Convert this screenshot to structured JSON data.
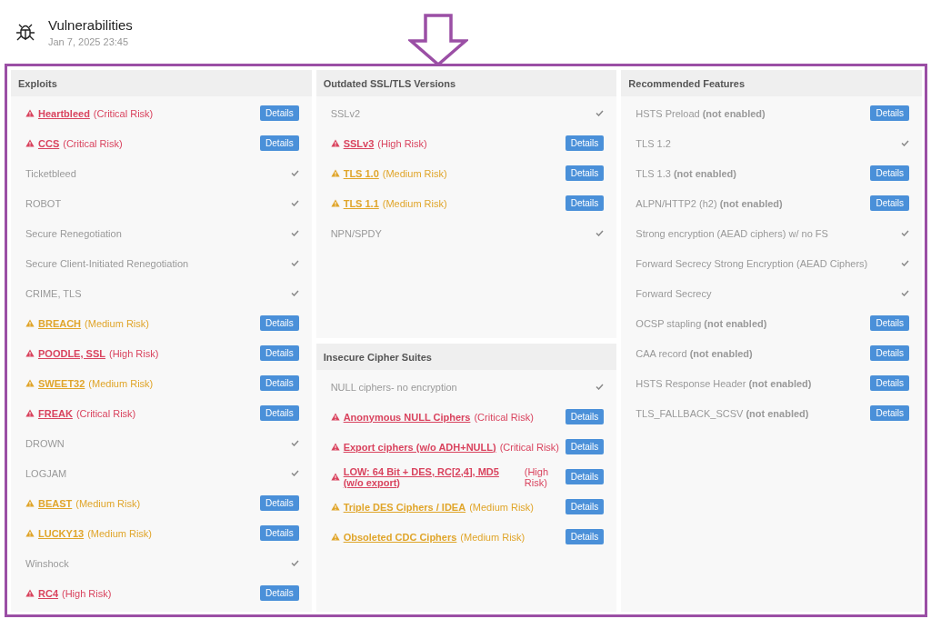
{
  "header": {
    "title": "Vulnerabilities",
    "date": "Jan 7, 2025 23:45"
  },
  "columns": [
    {
      "cards": [
        {
          "title": "Exploits",
          "items": [
            {
              "kind": "risk",
              "name": "Heartbleed",
              "risk": "(Critical Risk)",
              "color": "#d9435e",
              "button": "Details"
            },
            {
              "kind": "risk",
              "name": "CCS",
              "risk": "(Critical Risk)",
              "color": "#d9435e",
              "button": "Details"
            },
            {
              "kind": "ok",
              "name": "Ticketbleed"
            },
            {
              "kind": "ok",
              "name": "ROBOT"
            },
            {
              "kind": "ok",
              "name": "Secure Renegotiation"
            },
            {
              "kind": "ok",
              "name": "Secure Client-Initiated Renegotiation"
            },
            {
              "kind": "ok",
              "name": "CRIME, TLS"
            },
            {
              "kind": "risk",
              "name": "BREACH",
              "risk": "(Medium Risk)",
              "color": "#e0a52a",
              "button": "Details"
            },
            {
              "kind": "risk",
              "name": "POODLE, SSL",
              "risk": "(High Risk)",
              "color": "#d9435e",
              "button": "Details"
            },
            {
              "kind": "risk",
              "name": "SWEET32",
              "risk": "(Medium Risk)",
              "color": "#e0a52a",
              "button": "Details"
            },
            {
              "kind": "risk",
              "name": "FREAK",
              "risk": "(Critical Risk)",
              "color": "#d9435e",
              "button": "Details"
            },
            {
              "kind": "ok",
              "name": "DROWN"
            },
            {
              "kind": "ok",
              "name": "LOGJAM"
            },
            {
              "kind": "risk",
              "name": "BEAST",
              "risk": "(Medium Risk)",
              "color": "#e0a52a",
              "button": "Details"
            },
            {
              "kind": "risk",
              "name": "LUCKY13",
              "risk": "(Medium Risk)",
              "color": "#e0a52a",
              "button": "Details"
            },
            {
              "kind": "ok",
              "name": "Winshock"
            },
            {
              "kind": "risk",
              "name": "RC4",
              "risk": "(High Risk)",
              "color": "#d9435e",
              "button": "Details"
            }
          ]
        }
      ]
    },
    {
      "cards": [
        {
          "title": "Outdated SSL/TLS Versions",
          "items": [
            {
              "kind": "ok",
              "name": "SSLv2"
            },
            {
              "kind": "risk",
              "name": "SSLv3",
              "risk": "(High Risk)",
              "color": "#d9435e",
              "button": "Details"
            },
            {
              "kind": "risk",
              "name": "TLS 1.0",
              "risk": "(Medium Risk)",
              "color": "#e0a52a",
              "button": "Details"
            },
            {
              "kind": "risk",
              "name": "TLS 1.1",
              "risk": "(Medium Risk)",
              "color": "#e0a52a",
              "button": "Details"
            },
            {
              "kind": "ok",
              "name": "NPN/SPDY"
            }
          ]
        },
        {
          "title": "Insecure Cipher Suites",
          "items": [
            {
              "kind": "ok",
              "name": "NULL ciphers- no encryption"
            },
            {
              "kind": "risk",
              "name": "Anonymous NULL Ciphers",
              "risk": "(Critical Risk)",
              "color": "#d9435e",
              "button": "Details"
            },
            {
              "kind": "risk",
              "name": "Export ciphers (w/o ADH+NULL)",
              "risk": "(Critical Risk)",
              "color": "#d9435e",
              "button": "Details"
            },
            {
              "kind": "risk",
              "name": "LOW: 64 Bit + DES, RC[2,4], MD5 (w/o export)",
              "risk": "(High Risk)",
              "color": "#d9435e",
              "button": "Details"
            },
            {
              "kind": "risk",
              "name": "Triple DES Ciphers / IDEA",
              "risk": "(Medium Risk)",
              "color": "#e0a52a",
              "button": "Details"
            },
            {
              "kind": "risk",
              "name": "Obsoleted CDC Ciphers",
              "risk": "(Medium Risk)",
              "color": "#e0a52a",
              "button": "Details"
            }
          ]
        }
      ]
    },
    {
      "cards": [
        {
          "title": "Recommended Features",
          "items": [
            {
              "kind": "missing",
              "name": "HSTS Preload",
              "note": "(not enabled)",
              "button": "Details"
            },
            {
              "kind": "ok",
              "name": "TLS 1.2"
            },
            {
              "kind": "missing",
              "name": "TLS 1.3",
              "note": "(not enabled)",
              "button": "Details"
            },
            {
              "kind": "missing",
              "name": "ALPN/HTTP2 (h2)",
              "note": "(not enabled)",
              "button": "Details"
            },
            {
              "kind": "ok",
              "name": "Strong encryption (AEAD ciphers) w/ no FS"
            },
            {
              "kind": "ok",
              "name": "Forward Secrecy Strong Encryption (AEAD Ciphers)"
            },
            {
              "kind": "ok",
              "name": "Forward Secrecy"
            },
            {
              "kind": "missing",
              "name": "OCSP stapling",
              "note": "(not enabled)",
              "button": "Details"
            },
            {
              "kind": "missing",
              "name": "CAA record",
              "note": "(not enabled)",
              "button": "Details"
            },
            {
              "kind": "missing",
              "name": "HSTS Response Header",
              "note": "(not enabled)",
              "button": "Details"
            },
            {
              "kind": "missing",
              "name": "TLS_FALLBACK_SCSV",
              "note": "(not enabled)",
              "button": "Details"
            }
          ]
        }
      ]
    }
  ]
}
